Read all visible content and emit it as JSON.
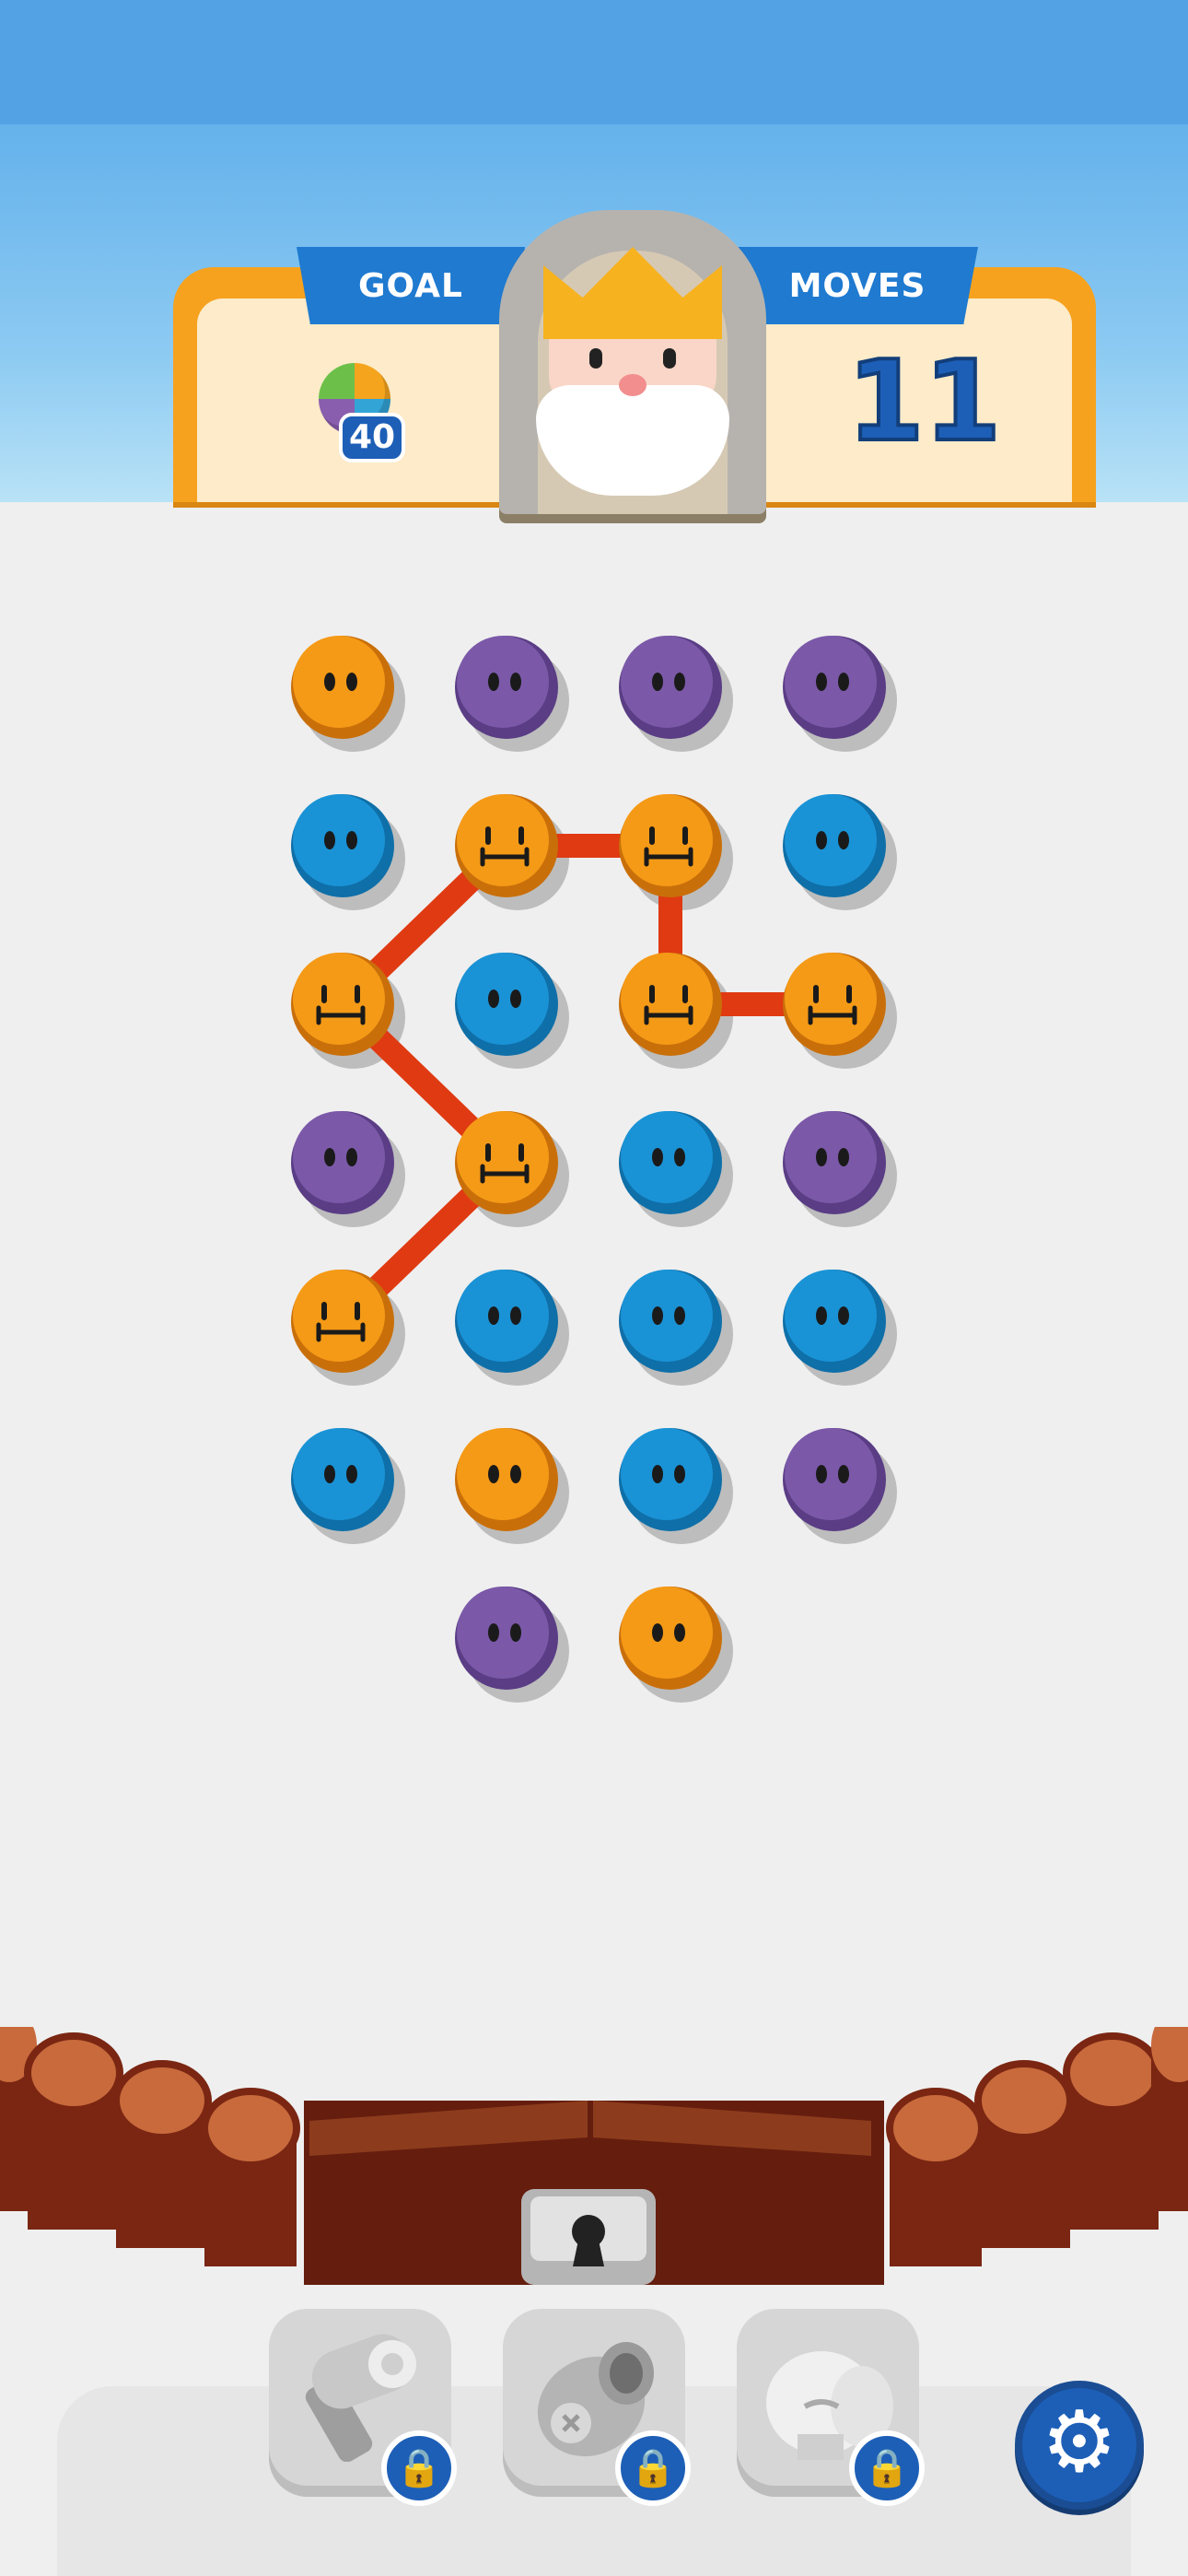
{
  "header": {
    "goal_label": "GOAL",
    "goal_count": "40",
    "goal_icon": "multicolor-ball-icon",
    "moves_label": "MOVES",
    "moves_value": "11"
  },
  "board": {
    "columns": 4,
    "rows": [
      [
        "orange",
        "purple",
        "purple",
        "purple"
      ],
      [
        "blue",
        "orange",
        "orange",
        "blue"
      ],
      [
        "orange",
        "blue",
        "orange",
        "orange"
      ],
      [
        "purple",
        "orange",
        "blue",
        "purple"
      ],
      [
        "orange",
        "blue",
        "blue",
        "blue"
      ],
      [
        "blue",
        "orange",
        "blue",
        "purple"
      ],
      [
        null,
        "purple",
        "orange",
        null
      ]
    ],
    "selected_path": [
      [
        4,
        0
      ],
      [
        3,
        1
      ],
      [
        2,
        0
      ],
      [
        1,
        1
      ],
      [
        1,
        2
      ],
      [
        2,
        2
      ],
      [
        2,
        3
      ]
    ],
    "colors": {
      "orange": "#f59a16",
      "purple": "#7b59a8",
      "blue": "#1a93d6",
      "path": "#e03a12"
    }
  },
  "boosters": [
    {
      "name": "hammer",
      "icon": "hammer-icon",
      "locked": true
    },
    {
      "name": "cannon",
      "icon": "cannon-icon",
      "locked": true
    },
    {
      "name": "boxing-glove",
      "icon": "boxing-glove-icon",
      "locked": true
    }
  ],
  "settings": {
    "icon": "gear-icon"
  },
  "lock_glyph": "🔒",
  "gear_glyph": "⚙"
}
